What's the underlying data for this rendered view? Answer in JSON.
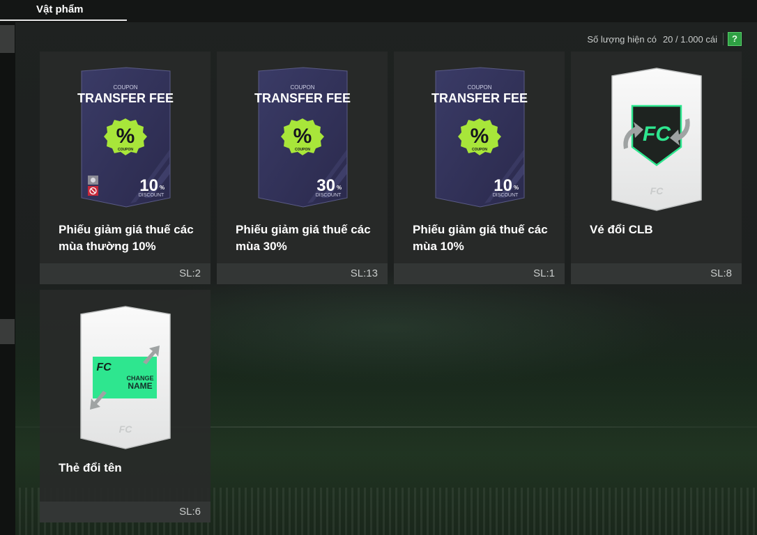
{
  "header": {
    "tab_label": "Vật phẩm"
  },
  "capacity": {
    "label": "Số lượng hiện có",
    "value": "20 / 1.000 cái",
    "help_icon": "?"
  },
  "colors": {
    "accent_green": "#2ea043",
    "coupon_purple": "#35345c",
    "coupon_badge": "#a8e63a",
    "name_card_green": "#2ee68f"
  },
  "items": [
    {
      "name": "Phiếu giảm giá thuế các mùa thường 10%",
      "qty": "SL:2",
      "kind": "coupon",
      "art": {
        "coupon": "COUPON",
        "title": "TRANSFER FEE",
        "badge_symbol": "%",
        "badge_label": "COUPON",
        "discount_value": "10",
        "discount_unit": "%",
        "discount_label": "DISCOUNT"
      }
    },
    {
      "name": "Phiếu giảm giá thuế các mùa 30%",
      "qty": "SL:13",
      "kind": "coupon",
      "art": {
        "coupon": "COUPON",
        "title": "TRANSFER FEE",
        "badge_symbol": "%",
        "badge_label": "COUPON",
        "discount_value": "30",
        "discount_unit": "%",
        "discount_label": "DISCOUNT"
      }
    },
    {
      "name": "Phiếu giảm giá thuế các mùa 10%",
      "qty": "SL:1",
      "kind": "coupon",
      "art": {
        "coupon": "COUPON",
        "title": "TRANSFER FEE",
        "badge_symbol": "%",
        "badge_label": "COUPON",
        "discount_value": "10",
        "discount_unit": "%",
        "discount_label": "DISCOUNT"
      }
    },
    {
      "name": "Vé đổi CLB",
      "qty": "SL:8",
      "kind": "club-change"
    },
    {
      "name": "Thẻ đổi tên",
      "qty": "SL:6",
      "kind": "name-change",
      "art": {
        "line1": "CHANGE",
        "line2": "NAME"
      }
    }
  ]
}
